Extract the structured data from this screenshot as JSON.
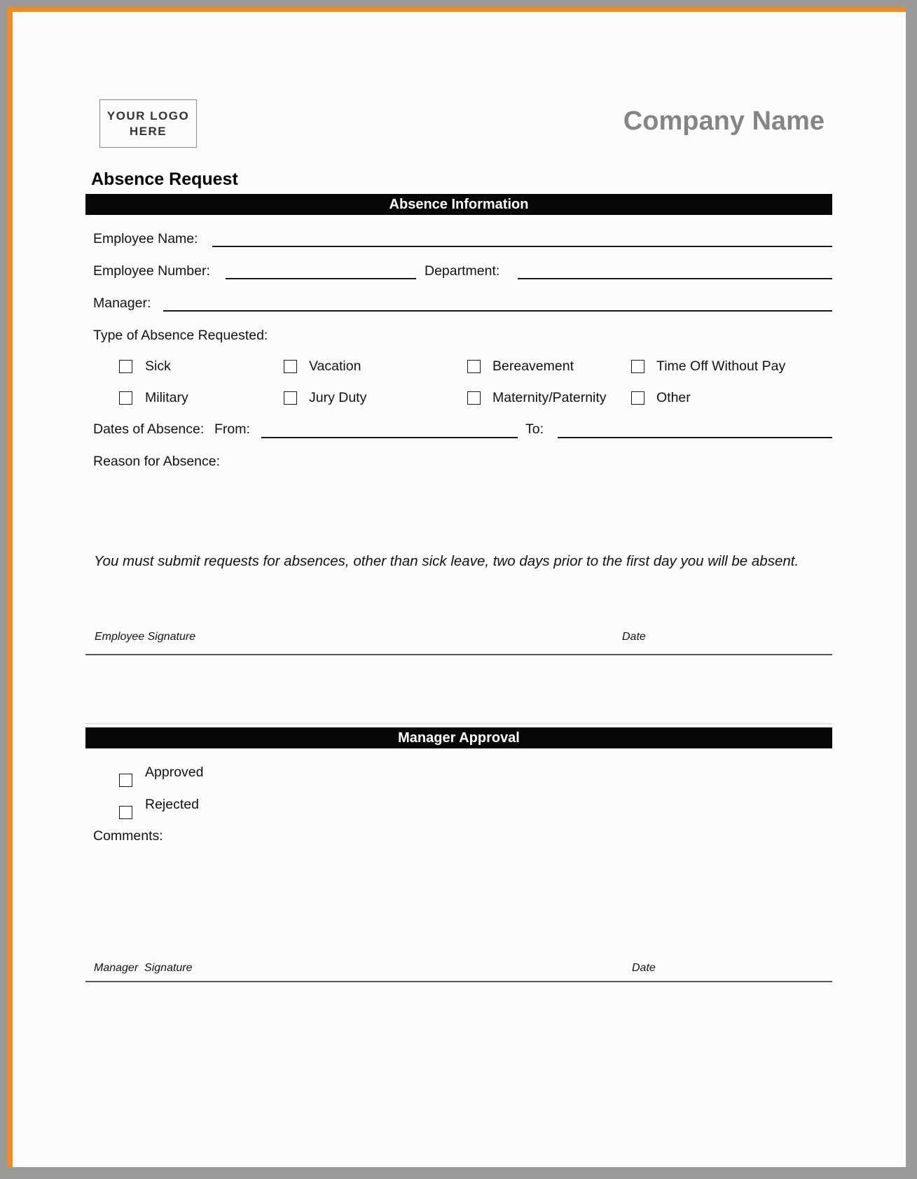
{
  "header": {
    "logo_line1": "YOUR LOGO",
    "logo_line2": "HERE",
    "company_name": "Company Name",
    "form_title": "Absence Request"
  },
  "absence_section": {
    "heading": "Absence Information",
    "employee_name_label": "Employee Name:",
    "employee_name_value": "",
    "employee_number_label": "Employee Number:",
    "employee_number_value": "",
    "department_label": "Department:",
    "department_value": "",
    "manager_label": "Manager:",
    "manager_value": "",
    "type_label": "Type of Absence Requested:",
    "types": [
      {
        "label": "Sick",
        "checked": false
      },
      {
        "label": "Vacation",
        "checked": false
      },
      {
        "label": "Bereavement",
        "checked": false
      },
      {
        "label": "Time Off Without Pay",
        "checked": false
      },
      {
        "label": "Military",
        "checked": false
      },
      {
        "label": "Jury Duty",
        "checked": false
      },
      {
        "label": "Maternity/Paternity",
        "checked": false
      },
      {
        "label": "Other",
        "checked": false
      }
    ],
    "dates_label": "Dates of Absence:",
    "from_label": "From:",
    "from_value": "",
    "to_label": "To:",
    "to_value": "",
    "reason_label": "Reason for Absence:",
    "reason_value": "",
    "notice": "You must submit requests for absences, other than sick leave, two days prior to the first day you will be absent.",
    "employee_signature_label": "Employee Signature",
    "employee_date_label": "Date"
  },
  "manager_section": {
    "heading": "Manager Approval",
    "options": [
      {
        "label": "Approved",
        "checked": false
      },
      {
        "label": "Rejected",
        "checked": false
      }
    ],
    "comments_label": "Comments:",
    "comments_value": "",
    "manager_signature_label": "Manager  Signature",
    "manager_date_label": "Date"
  },
  "colors": {
    "frame": "#f18a1f",
    "band": "#070707",
    "company_name": "#858585"
  }
}
